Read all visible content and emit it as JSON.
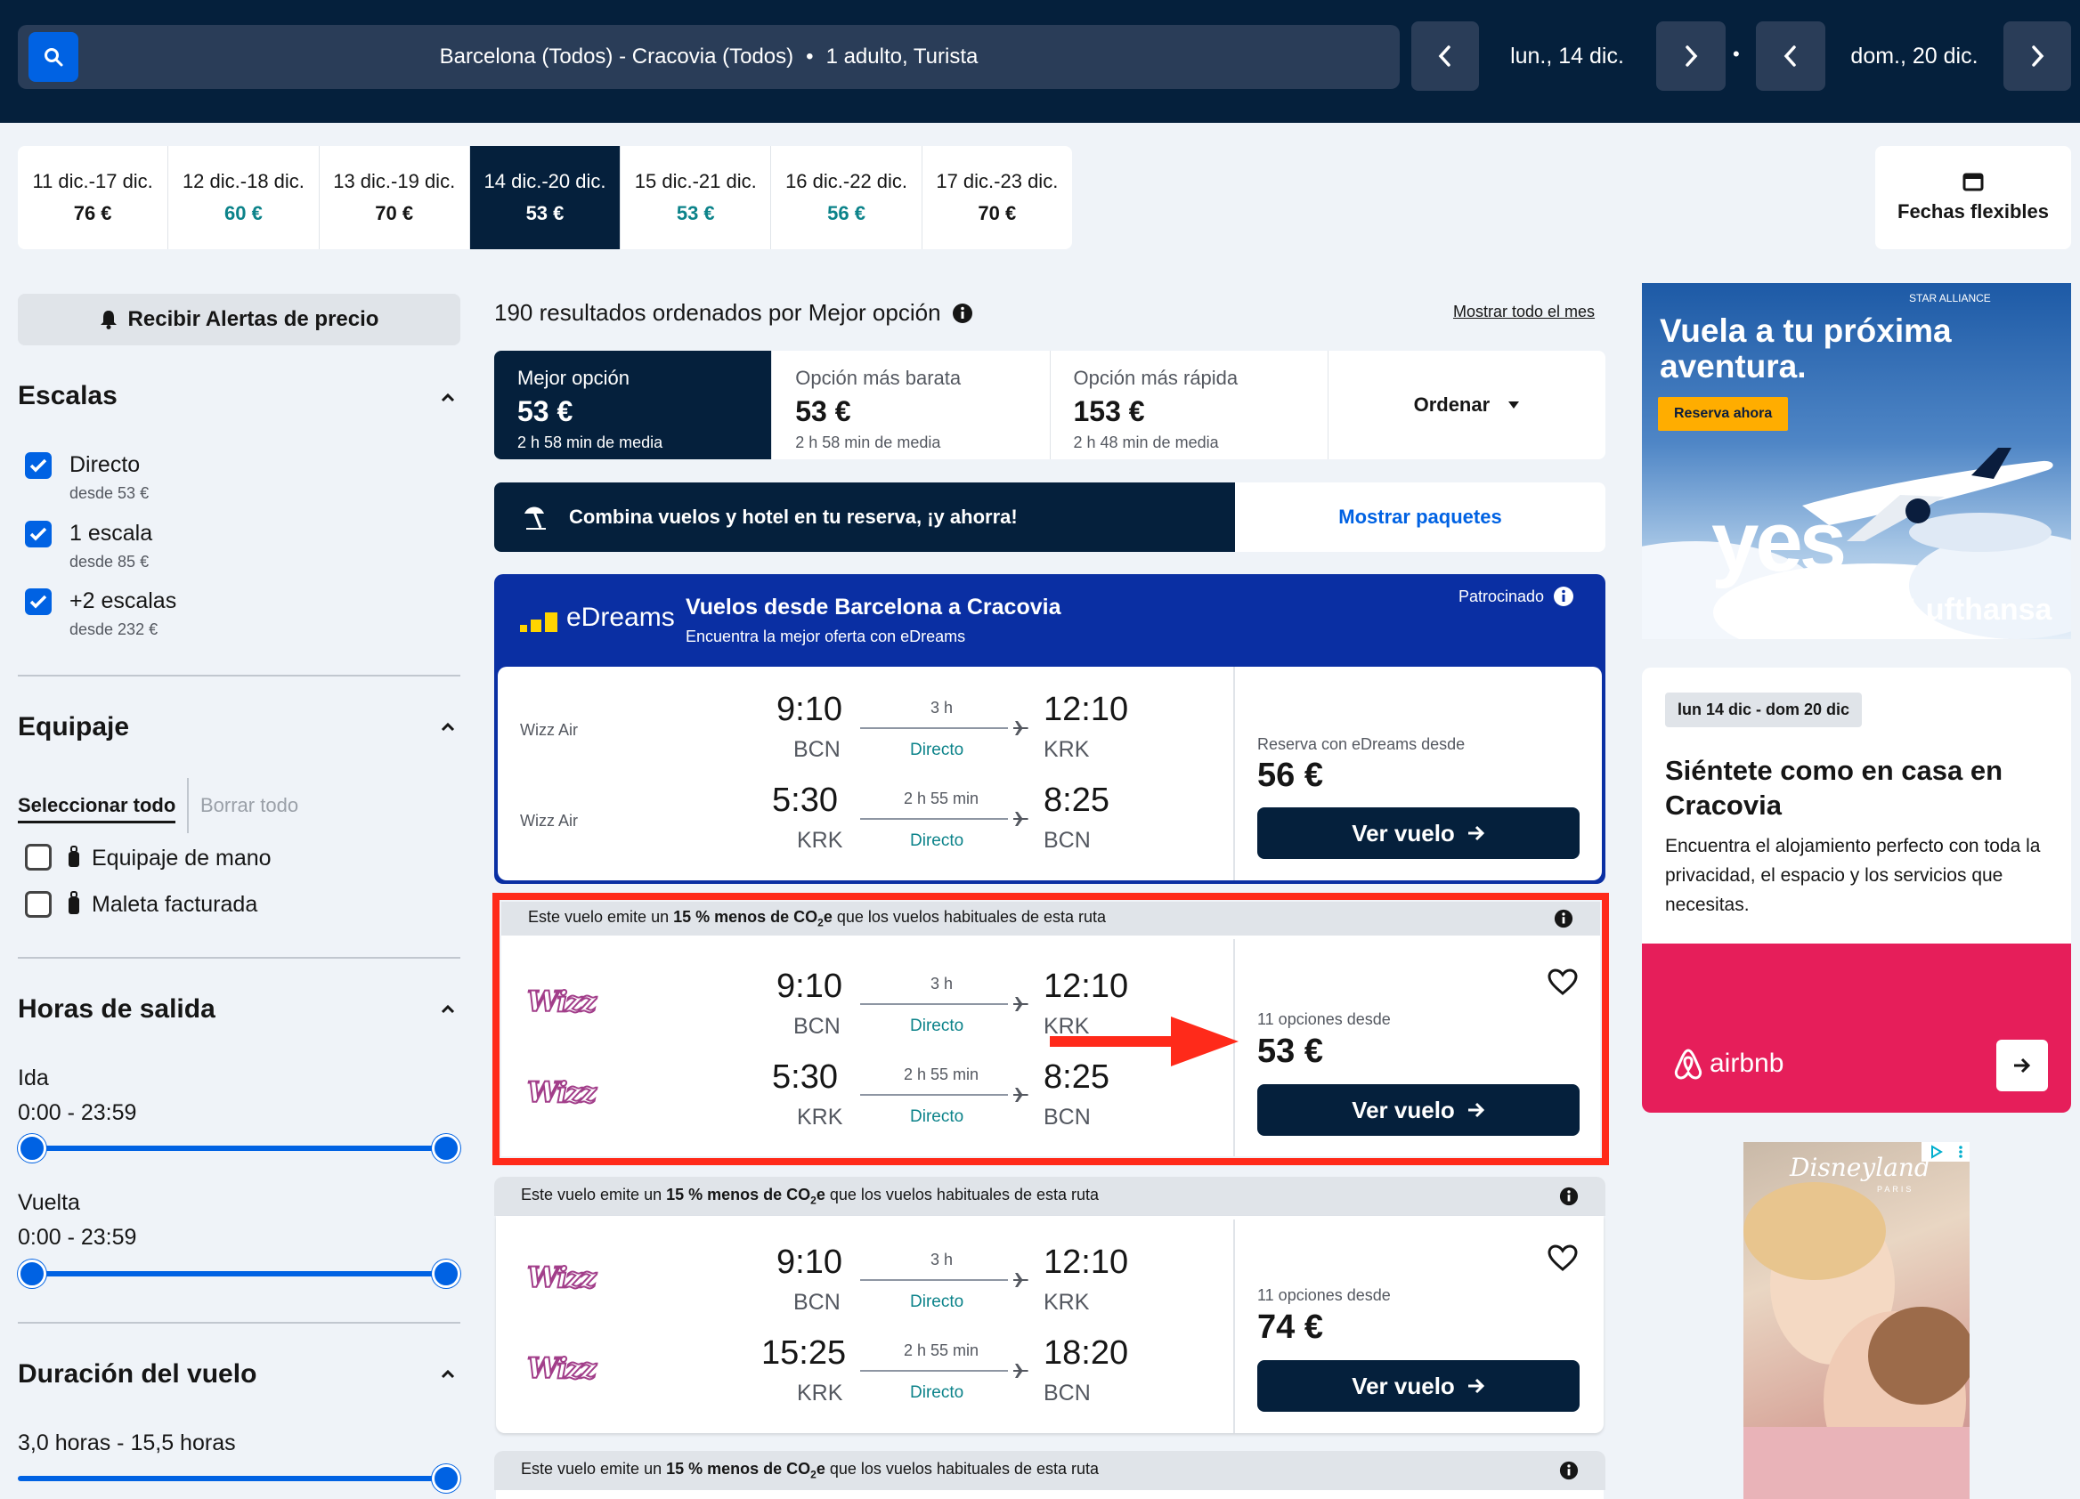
{
  "search": {
    "route": "Barcelona (Todos) - Cracovia (Todos)",
    "passengers": "1 adulto, Turista",
    "separator": "•",
    "depart_date": "lun., 14 dic.",
    "return_date": "dom., 20 dic."
  },
  "weeks": [
    {
      "dates": "11 dic.-17 dic.",
      "price": "76 €"
    },
    {
      "dates": "12 dic.-18 dic.",
      "price": "60 €"
    },
    {
      "dates": "13 dic.-19 dic.",
      "price": "70 €"
    },
    {
      "dates": "14 dic.-20 dic.",
      "price": "53 €"
    },
    {
      "dates": "15 dic.-21 dic.",
      "price": "53 €"
    },
    {
      "dates": "16 dic.-22 dic.",
      "price": "56 €"
    },
    {
      "dates": "17 dic.-23 dic.",
      "price": "70 €"
    }
  ],
  "flexible": {
    "label": "Fechas flexibles"
  },
  "sidebar": {
    "alert_label": "Recibir Alertas de precio",
    "stops": {
      "title": "Escalas",
      "items": [
        {
          "label": "Directo",
          "sub": "desde 53 €",
          "checked": true
        },
        {
          "label": "1 escala",
          "sub": "desde 85 €",
          "checked": true
        },
        {
          "label": "+2 escalas",
          "sub": "desde 232 €",
          "checked": true
        }
      ]
    },
    "baggage": {
      "title": "Equipaje",
      "select_all": "Seleccionar todo",
      "clear_all": "Borrar todo",
      "items": [
        {
          "label": "Equipaje de mano",
          "checked": false
        },
        {
          "label": "Maleta facturada",
          "checked": false
        }
      ]
    },
    "times": {
      "title": "Horas de salida",
      "outbound_label": "Ida",
      "outbound_range": "0:00 - 23:59",
      "return_label": "Vuelta",
      "return_range": "0:00 - 23:59"
    },
    "duration": {
      "title": "Duración del vuelo",
      "range": "3,0 horas - 15,5 horas"
    }
  },
  "results": {
    "count_text": "190 resultados ordenados por Mejor opción",
    "month_link": "Mostrar todo el mes",
    "sort": [
      {
        "label": "Mejor opción",
        "price": "53 €",
        "sub": "2 h 58 min de media"
      },
      {
        "label": "Opción más barata",
        "price": "53 €",
        "sub": "2 h 58 min de media"
      },
      {
        "label": "Opción más rápida",
        "price": "153 €",
        "sub": "2 h 48 min de media"
      }
    ],
    "order_label": "Ordenar",
    "package_text": "Combina vuelos y hotel en tu reserva, ¡y ahorra!",
    "package_link": "Mostrar paquetes"
  },
  "sponsored": {
    "brand": "eDreams",
    "title": "Vuelos desde Barcelona a Cracovia",
    "subtitle": "Encuentra la mejor oferta con eDreams",
    "tag": "Patrocinado",
    "out": {
      "airline": "Wizz Air",
      "dep": "9:10",
      "dep_ap": "BCN",
      "dur": "3 h",
      "type": "Directo",
      "arr": "12:10",
      "arr_ap": "KRK"
    },
    "ret": {
      "airline": "Wizz Air",
      "dep": "5:30",
      "dep_ap": "KRK",
      "dur": "2 h 55 min",
      "type": "Directo",
      "arr": "8:25",
      "arr_ap": "BCN"
    },
    "price_label": "Reserva con eDreams desde",
    "price": "56 €",
    "button": "Ver vuelo"
  },
  "co2": {
    "pre": "Este vuelo emite un ",
    "bold1": "15 % menos de CO",
    "sub": "2",
    "bold2": "e",
    "post": " que los vuelos habituales de esta ruta"
  },
  "flights": [
    {
      "airline_logo": "Wizz",
      "out": {
        "dep": "9:10",
        "dep_ap": "BCN",
        "dur": "3 h",
        "type": "Directo",
        "arr": "12:10",
        "arr_ap": "KRK"
      },
      "ret": {
        "dep": "5:30",
        "dep_ap": "KRK",
        "dur": "2 h 55 min",
        "type": "Directo",
        "arr": "8:25",
        "arr_ap": "BCN"
      },
      "options": "11 opciones desde",
      "price": "53 €",
      "button": "Ver vuelo"
    },
    {
      "airline_logo": "Wizz",
      "out": {
        "dep": "9:10",
        "dep_ap": "BCN",
        "dur": "3 h",
        "type": "Directo",
        "arr": "12:10",
        "arr_ap": "KRK"
      },
      "ret": {
        "dep": "15:25",
        "dep_ap": "KRK",
        "dur": "2 h 55 min",
        "type": "Directo",
        "arr": "18:20",
        "arr_ap": "BCN"
      },
      "options": "11 opciones desde",
      "price": "74 €",
      "button": "Ver vuelo"
    }
  ],
  "ads": {
    "lufthansa": {
      "alliance": "STAR ALLIANCE",
      "headline": "Vuela a tu próxima aventura.",
      "cta": "Reserva ahora",
      "yes": "yes",
      "brand": "Lufthansa"
    },
    "airbnb": {
      "dates": "lun 14 dic - dom 20 dic",
      "title": "Siéntete como en casa en Cracovia",
      "body": "Encuentra el alojamiento perfecto con toda la privacidad, el espacio y los servicios que necesitas.",
      "brand": "airbnb"
    },
    "disney": {
      "brand": "Disneyland",
      "sub": "PARIS"
    }
  },
  "colors": {
    "navy": "#05203c",
    "blue": "#0062e3",
    "teal": "#0c838a",
    "highlight": "#ff2a1a",
    "edreams": "#0a2fa3",
    "airbnb": "#e61e5a"
  }
}
